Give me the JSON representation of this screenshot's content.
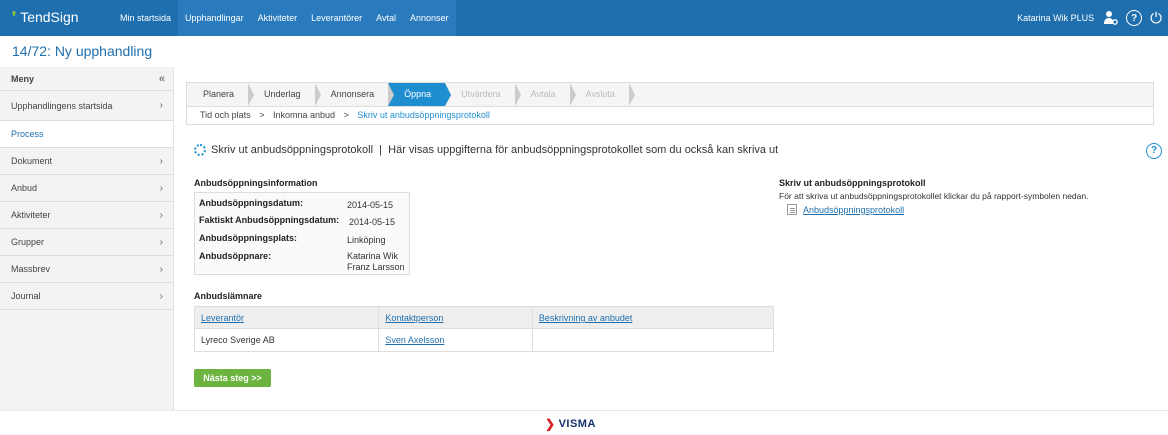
{
  "app": {
    "name": "TendSign"
  },
  "nav": [
    "Min startsida",
    "Upphandlingar",
    "Aktiviteter",
    "Leverantörer",
    "Avtal",
    "Annonser"
  ],
  "user": {
    "name": "Katarina Wik PLUS"
  },
  "page_title": "14/72: Ny upphandling",
  "sidebar": {
    "header": "Meny",
    "collapse_glyph": "«",
    "items": [
      {
        "label": "Upphandlingens startsida",
        "chevron": true
      },
      {
        "label": "Process",
        "chevron": false
      },
      {
        "label": "Dokument",
        "chevron": true
      },
      {
        "label": "Anbud",
        "chevron": true
      },
      {
        "label": "Aktiviteter",
        "chevron": true
      },
      {
        "label": "Grupper",
        "chevron": true
      },
      {
        "label": "Massbrev",
        "chevron": true
      },
      {
        "label": "Journal",
        "chevron": true
      }
    ]
  },
  "steps": [
    {
      "label": "Planera",
      "state": "done"
    },
    {
      "label": "Underlag",
      "state": "done"
    },
    {
      "label": "Annonsera",
      "state": "done"
    },
    {
      "label": "Öppna",
      "state": "active"
    },
    {
      "label": "Utvärdera",
      "state": "disabled"
    },
    {
      "label": "Avtala",
      "state": "disabled"
    },
    {
      "label": "Avsluta",
      "state": "disabled"
    }
  ],
  "breadcrumb": [
    "Tid och plats",
    "Inkomna anbud",
    "Skriv ut anbudsöppningsprotokoll"
  ],
  "breadcrumb_sep": ">",
  "section_heading": "Skriv ut anbudsöppningsprotokoll  |  Här visas uppgifterna för anbudsöppningsprotokollet som du också kan skriva ut",
  "info": {
    "title": "Anbudsöppningsinformation",
    "rows": [
      {
        "label": "Anbudsöppningsdatum:",
        "value": "2014-05-15"
      },
      {
        "label": "Faktiskt Anbudsöppningsdatum:",
        "value": "2014-05-15"
      },
      {
        "label": "Anbudsöppningsplats:",
        "value": "Linköping"
      },
      {
        "label": "Anbudsöppnare:",
        "value": "Katarina Wik",
        "value2": "Franz Larsson"
      }
    ]
  },
  "print": {
    "title": "Skriv ut anbudsöppningsprotokoll",
    "desc": "För att skriva ut anbudsöppningsprotokollet klickar du på rapport-symbolen nedan.",
    "link": "Anbudsöppningsprotokoll"
  },
  "bidders": {
    "title": "Anbudslämnare",
    "columns": [
      "Leverantör",
      "Kontaktperson",
      "Beskrivning av anbudet"
    ],
    "rows": [
      [
        "Lyreco Sverige AB",
        "Sven Axelsson",
        ""
      ]
    ]
  },
  "next_button": "Nästa steg >>",
  "footer": {
    "brand": "VISMA"
  }
}
